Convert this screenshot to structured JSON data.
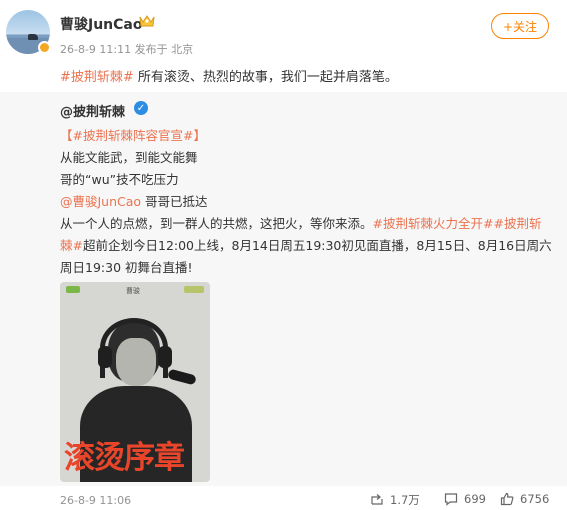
{
  "header": {
    "username": "曹骏JunCao",
    "meta": "26-8-9 11:11  发布于 北京",
    "follow_label": "+关注"
  },
  "main_post": {
    "tag": "#披荆斩棘#",
    "text": " 所有滚烫、热烈的故事，我们一起并肩落笔。"
  },
  "repost": {
    "author": "@披荆斩棘",
    "line1": "【#披荆斩棘阵容官宣#】",
    "line2": "从能文能武，到能文能舞",
    "line3": "哥的“wu”技不吃压力",
    "line4_mention": "@曹骏JunCao",
    "line4_text": " 哥哥已抵达",
    "line5_text": "从一个人的点燃，到一群人的共燃，这把火，等你来添。",
    "line5_tag1": "#披荆斩棘火力全开#",
    "line5_tag2a": "#披荆斩",
    "line6_tag2b": "棘#",
    "line6_text": "超前企划今日12:00上线，8月14日周五19:30初见面直播，8月15日、8月16日周六",
    "line7_text": "周日19:30 初舞台直播!",
    "poster": {
      "mark": "曹骏",
      "title": "滚烫序章"
    }
  },
  "footer": {
    "time": "26-8-9 11:06",
    "reposts": "1.7万",
    "comments": "699",
    "likes": "6756"
  },
  "colors": {
    "accent": "#ff8200",
    "tag": "#eb7350",
    "verified": "#2d8de5"
  }
}
